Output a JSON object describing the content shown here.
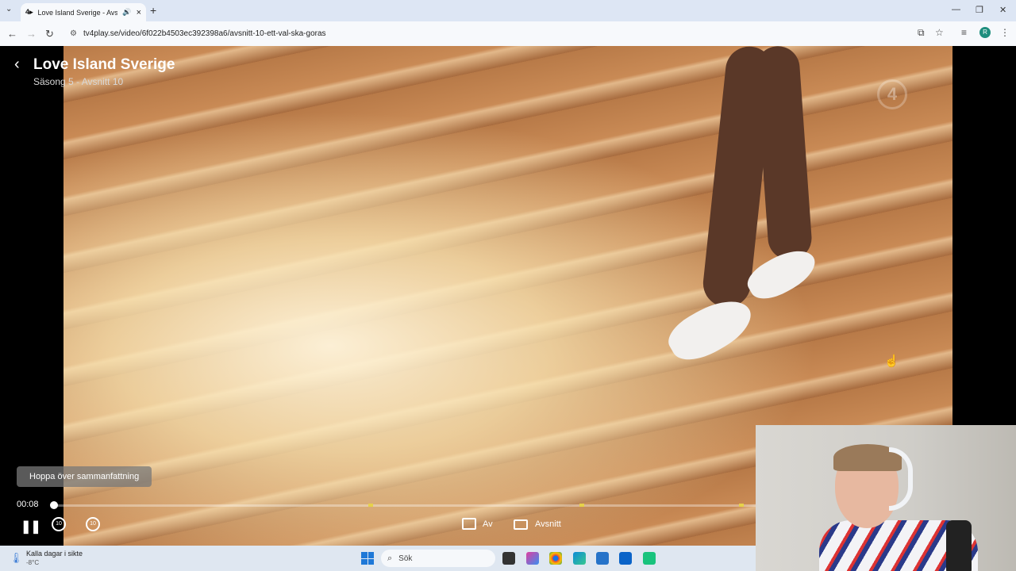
{
  "browser": {
    "tab_title": "Love Island Sverige - Avsnit",
    "tab_favicon": "4▸",
    "new_tab": "+",
    "url": "tv4play.se/video/6f022b4503ec392398a6/avsnitt-10-ett-val-ska-goras",
    "profile_initial": "R"
  },
  "player": {
    "show_title": "Love Island Sverige",
    "episode_info": "Säsong 5 - Avsnitt 10",
    "skip_label": "Hoppa över sammanfattning",
    "current_time": "00:08",
    "progress": 0.01,
    "rewind_label": "10",
    "forward_label": "10",
    "subtitles_label": "Av",
    "episodes_label": "Avsnitt",
    "channel_logo": "4"
  },
  "taskbar": {
    "weather_title": "Kalla dagar i sikte",
    "weather_temp": "-8°C",
    "search_placeholder": "Sök"
  },
  "colors": {
    "marker": "#e6d24a",
    "taskbar": "#dfe7f1"
  }
}
